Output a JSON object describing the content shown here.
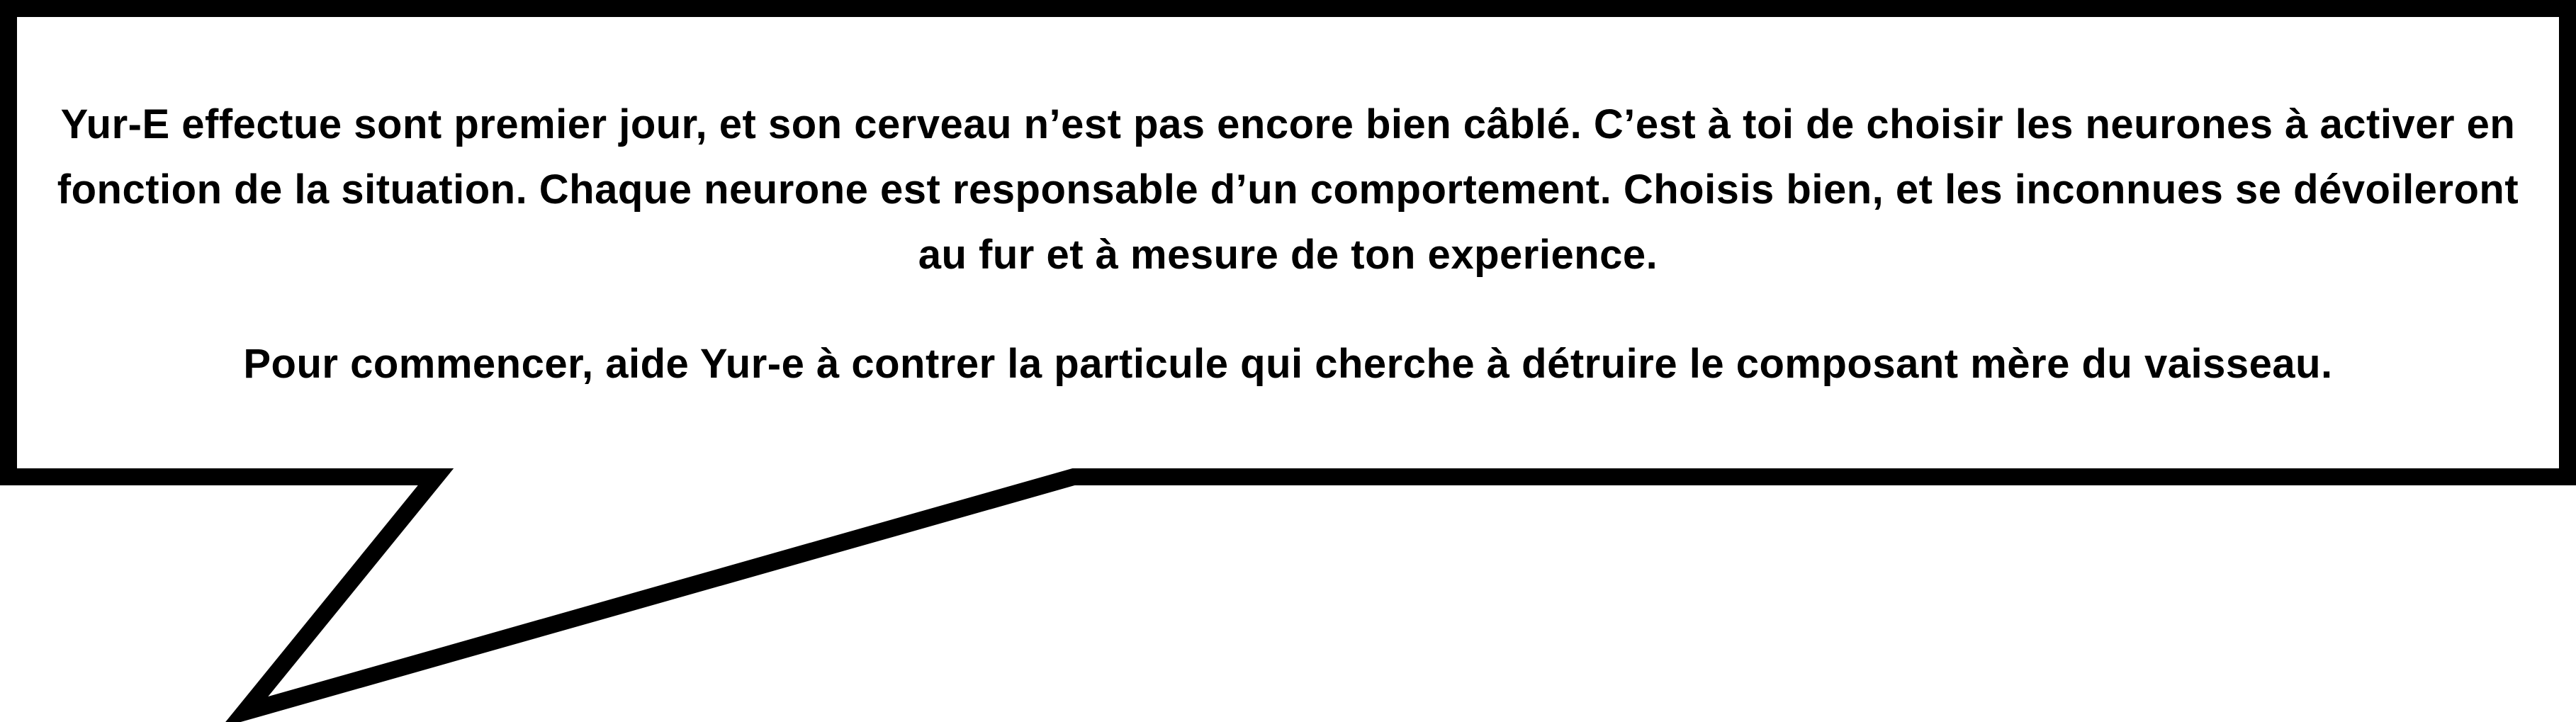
{
  "dialog": {
    "paragraph_1": "Yur-E effectue sont premier jour, et son cerveau n’est pas encore bien câblé. C’est à toi de choisir les neurones à activer en fonction de la situation. Chaque neurone est responsable d’un comportement. Choisis bien, et les inconnues se dévoileront au fur et à mesure de ton experience.",
    "paragraph_2": "Pour commencer, aide Yur-e à contrer la particule qui cherche à détruire le composant mère du vaisseau."
  },
  "colors": {
    "background": "#ffffff",
    "bubble_fill": "#ffffff",
    "bubble_border": "#000000",
    "text": "#000000"
  }
}
